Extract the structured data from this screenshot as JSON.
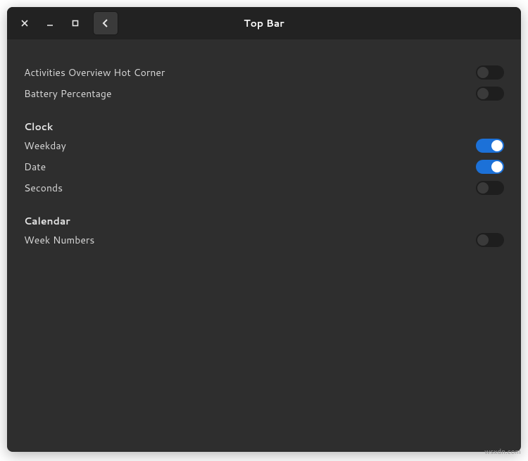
{
  "header": {
    "title": "Top Bar"
  },
  "settings": {
    "activities_overview_label": "Activities Overview Hot Corner",
    "activities_overview_on": false,
    "battery_percentage_label": "Battery Percentage",
    "battery_percentage_on": false
  },
  "clock": {
    "heading": "Clock",
    "weekday_label": "Weekday",
    "weekday_on": true,
    "date_label": "Date",
    "date_on": true,
    "seconds_label": "Seconds",
    "seconds_on": false
  },
  "calendar": {
    "heading": "Calendar",
    "week_numbers_label": "Week Numbers",
    "week_numbers_on": false
  },
  "watermark": "wsxdn.com"
}
